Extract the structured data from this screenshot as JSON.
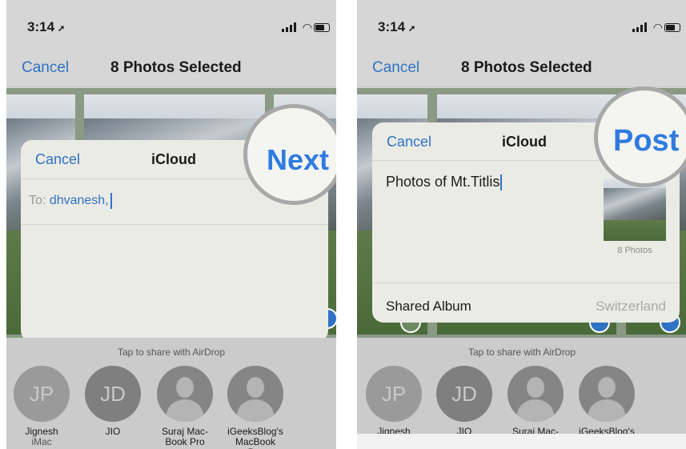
{
  "left": {
    "status": {
      "time": "3:14"
    },
    "nav": {
      "cancel": "Cancel",
      "title": "8 Photos Selected"
    },
    "sheet": {
      "cancel": "Cancel",
      "title": "iCloud",
      "to_label": "To:",
      "to_value": "dhvanesh,"
    },
    "magnifier": {
      "text": "Next"
    },
    "airdrop": {
      "label": "Tap to share with AirDrop",
      "people": [
        {
          "initials": "JP",
          "name": "Jignesh",
          "sub": "iMac"
        },
        {
          "initials": "JD",
          "name": "JIO",
          "sub": ""
        },
        {
          "initials": "",
          "name": "Suraj Mac-",
          "sub": "Book Pro"
        },
        {
          "initials": "",
          "name": "iGeeksBlog's",
          "sub": "MacBook Pro"
        }
      ]
    }
  },
  "right": {
    "status": {
      "time": "3:14"
    },
    "nav": {
      "cancel": "Cancel",
      "title": "8 Photos Selected"
    },
    "sheet": {
      "cancel": "Cancel",
      "title": "iCloud",
      "comment": "Photos of Mt.Titlis",
      "photo_count": "8 Photos",
      "album_label": "Shared Album",
      "album_value": "Switzerland"
    },
    "magnifier": {
      "text": "Post"
    },
    "airdrop": {
      "label": "Tap to share with AirDrop",
      "people": [
        {
          "initials": "JP",
          "name": "Jignesh"
        },
        {
          "initials": "JD",
          "name": "JIO"
        },
        {
          "initials": "",
          "name": "Suraj Mac-"
        },
        {
          "initials": "",
          "name": "iGeeksBlog's"
        }
      ]
    }
  },
  "colors": {
    "ios_blue": "#2f72c4",
    "magnifier_blue": "#2f7be0",
    "sheet_bg": "#ebebe6"
  },
  "icons": [
    "location-arrow-icon",
    "signal-icon",
    "wifi-icon",
    "battery-icon",
    "contact-silhouette-icon",
    "selection-check-icon"
  ]
}
